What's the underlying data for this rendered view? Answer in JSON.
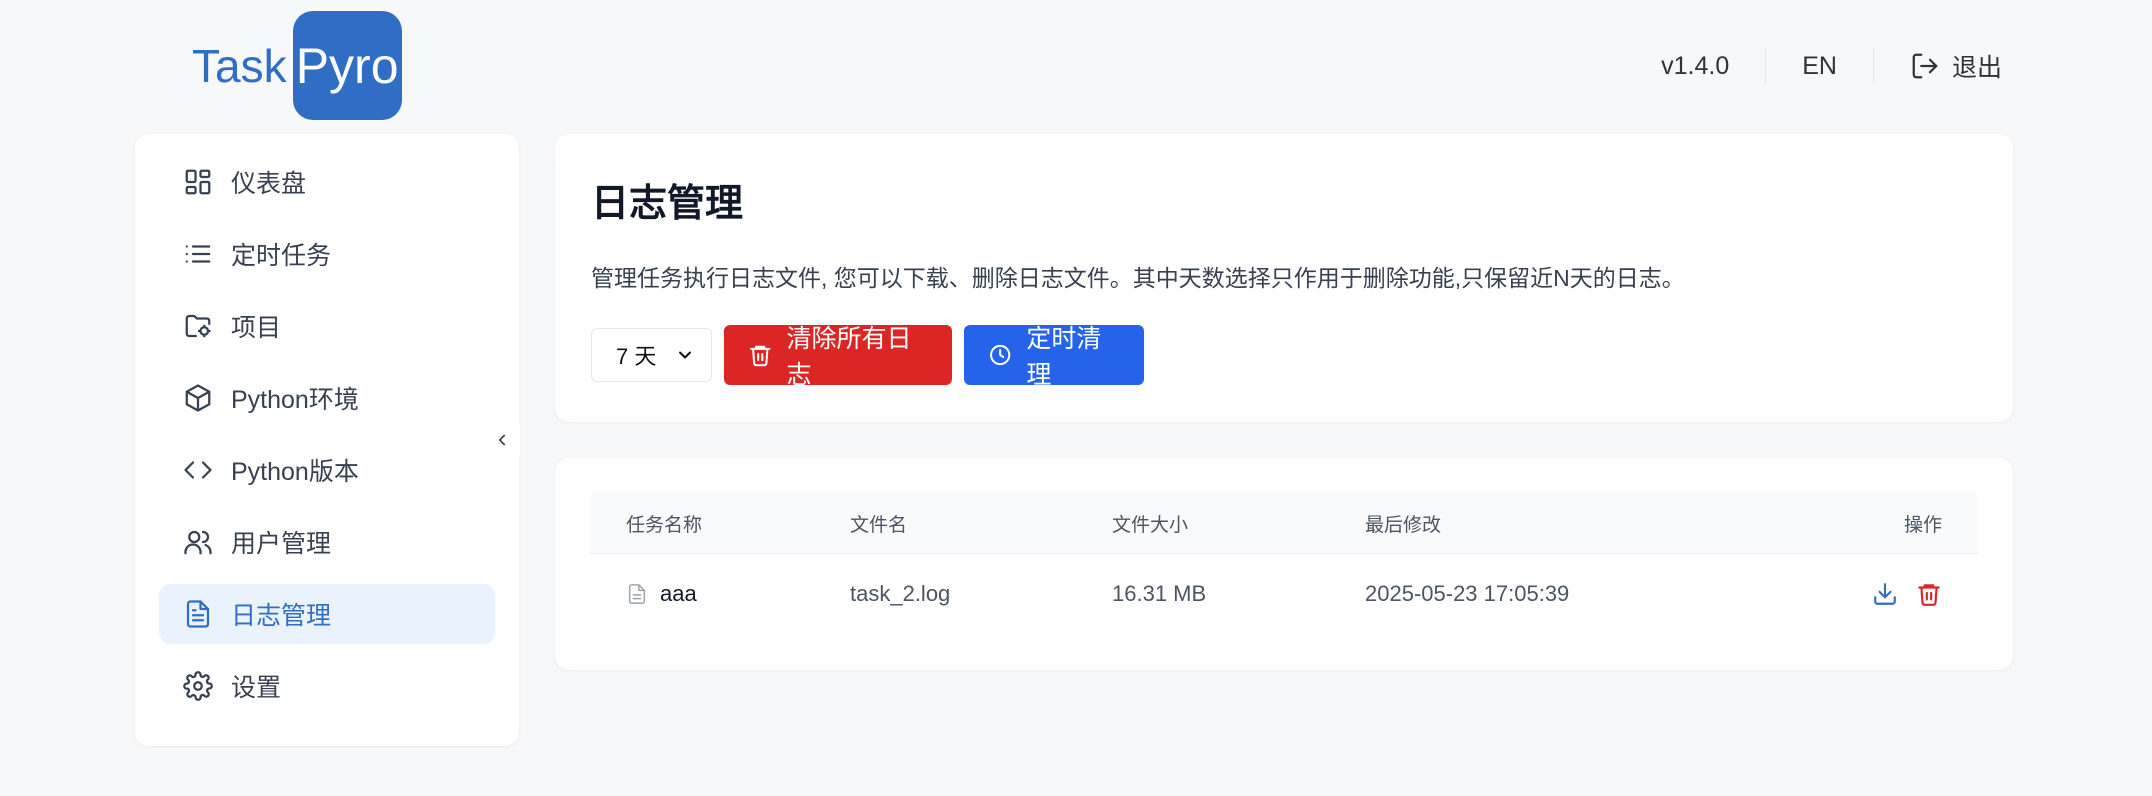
{
  "logo": {
    "part1": "Task",
    "part2": "Pyro"
  },
  "header": {
    "version": "v1.4.0",
    "lang": "EN",
    "logout": "退出"
  },
  "sidebar": {
    "items": [
      {
        "label": "仪表盘",
        "icon": "dashboard-icon"
      },
      {
        "label": "定时任务",
        "icon": "list-icon"
      },
      {
        "label": "项目",
        "icon": "folder-icon"
      },
      {
        "label": "Python环境",
        "icon": "box-icon"
      },
      {
        "label": "Python版本",
        "icon": "code-icon"
      },
      {
        "label": "用户管理",
        "icon": "users-icon"
      },
      {
        "label": "日志管理",
        "icon": "file-text-icon",
        "active": true
      },
      {
        "label": "设置",
        "icon": "gear-icon"
      }
    ]
  },
  "main": {
    "title": "日志管理",
    "description": "管理任务执行日志文件, 您可以下载、删除日志文件。其中天数选择只作用于删除功能,只保留近N天的日志。",
    "days_select": "7 天",
    "clear_all": "清除所有日志",
    "scheduled_clean": "定时清理"
  },
  "table": {
    "headers": [
      "任务名称",
      "文件名",
      "文件大小",
      "最后修改",
      "操作"
    ],
    "rows": [
      {
        "task": "aaa",
        "file": "task_2.log",
        "size": "16.31 MB",
        "modified": "2025-05-23 17:05:39"
      }
    ]
  },
  "colors": {
    "brand": "#2f6ec4",
    "danger": "#dc2626",
    "primary": "#2563eb"
  }
}
